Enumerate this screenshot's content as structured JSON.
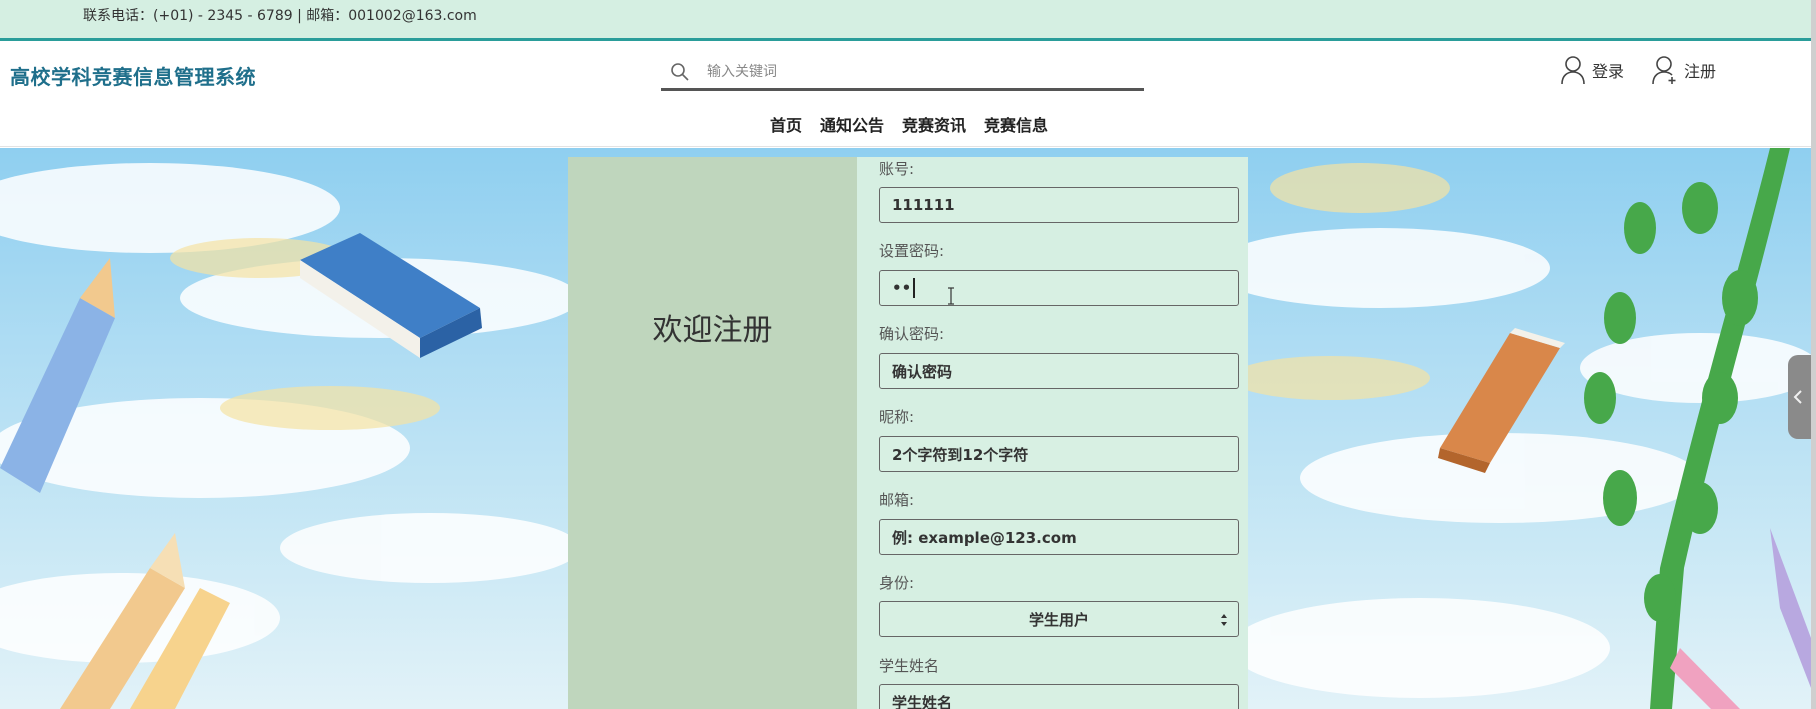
{
  "topbar": {
    "contact": "联系电话：(+01) - 2345 - 6789 | 邮箱：001002@163.com"
  },
  "header": {
    "brand": "高校学科竞赛信息管理系统",
    "search_placeholder": "输入关键词",
    "login_label": "登录",
    "register_label": "注册",
    "nav": [
      "首页",
      "通知公告",
      "竞赛资讯",
      "竞赛信息"
    ]
  },
  "card": {
    "welcome": "欢迎注册",
    "fields": {
      "account": {
        "label": "账号:",
        "value": "111111"
      },
      "password": {
        "label": "设置密码:",
        "value": "••"
      },
      "confirm": {
        "label": "确认密码:",
        "value": "确认密码"
      },
      "nickname": {
        "label": "昵称:",
        "value": "2个字符到12个字符"
      },
      "email": {
        "label": "邮箱:",
        "value": "例: example@123.com"
      },
      "identity": {
        "label": "身份:",
        "value": "学生用户"
      },
      "student_name": {
        "label": "学生姓名",
        "value": "学生姓名"
      }
    }
  },
  "colors": {
    "topbar_bg": "#d5efe2",
    "topbar_border": "#2a9d9a",
    "brand": "#1f6f8b",
    "card_left": "#bfd6bd",
    "card_right": "#d6efe2"
  },
  "icons": {
    "search": "search-icon",
    "login": "user-icon",
    "register": "user-add-icon",
    "select": "select-arrows-icon",
    "side": "chevron-left-icon"
  }
}
